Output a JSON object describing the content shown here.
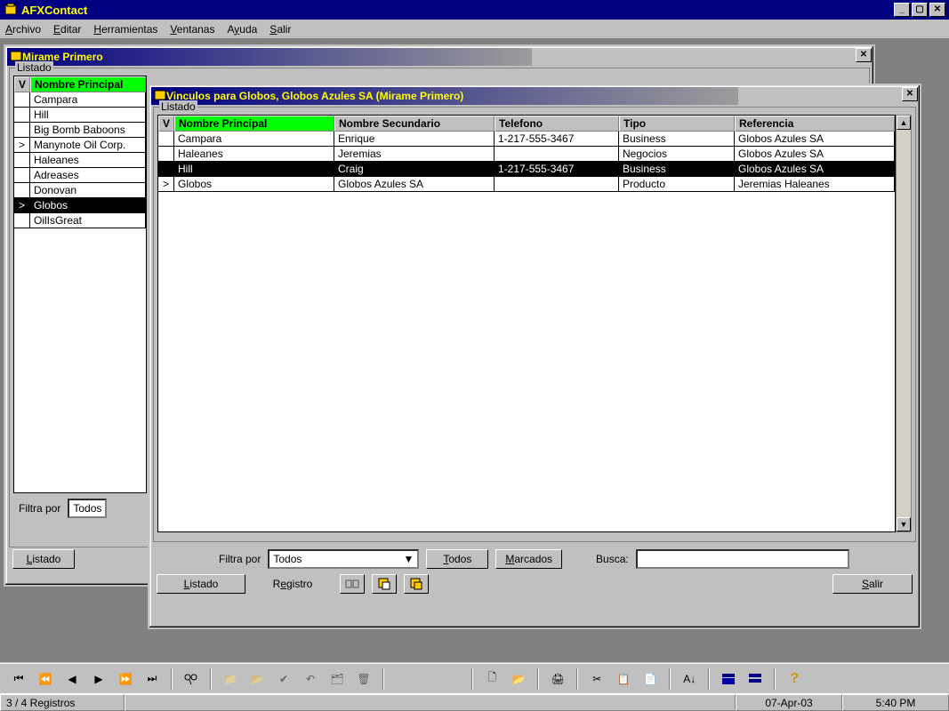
{
  "app": {
    "title": "AFXContact"
  },
  "menu": {
    "archivo": "Archivo",
    "editar": "Editar",
    "herramientas": "Herramientas",
    "ventanas": "Ventanas",
    "ayuda": "Ayuda",
    "salir": "Salir"
  },
  "win1": {
    "title": "Mirame Primero",
    "listado": "Listado",
    "headers": {
      "v": "V",
      "nombre": "Nombre Principal"
    },
    "rows": [
      {
        "m": "",
        "name": "Campara",
        "sel": false
      },
      {
        "m": "",
        "name": "Hill",
        "sel": false
      },
      {
        "m": "",
        "name": "Big Bomb Baboons",
        "sel": false
      },
      {
        "m": ">",
        "name": "Manynote Oil Corp.",
        "sel": false
      },
      {
        "m": "",
        "name": "Haleanes",
        "sel": false
      },
      {
        "m": "",
        "name": "Adreases",
        "sel": false
      },
      {
        "m": "",
        "name": "Donovan",
        "sel": false
      },
      {
        "m": ">",
        "name": "Globos",
        "sel": true
      },
      {
        "m": "",
        "name": "OilIsGreat",
        "sel": false
      }
    ],
    "filtra": "Filtra por",
    "filtra_val": "Todos",
    "btn_listado": "Listado"
  },
  "win2": {
    "title": "Vinculos para Globos, Globos Azules SA (Mirame Primero)",
    "listado": "Listado",
    "headers": {
      "v": "V",
      "nombre": "Nombre Principal",
      "sec": "Nombre Secundario",
      "tel": "Telefono",
      "tipo": "Tipo",
      "ref": "Referencia"
    },
    "rows": [
      {
        "m": "",
        "p": "Campara",
        "s": "Enrique",
        "t": "1-217-555-3467",
        "ti": "Business",
        "r": "Globos Azules SA",
        "sel": false
      },
      {
        "m": "",
        "p": "Haleanes",
        "s": "Jeremias",
        "t": "",
        "ti": "Negocios",
        "r": "Globos Azules SA",
        "sel": false
      },
      {
        "m": "",
        "p": "Hill",
        "s": "Craig",
        "t": "1-217-555-3467",
        "ti": "Business",
        "r": "Globos Azules SA",
        "sel": true
      },
      {
        "m": ">",
        "p": "Globos",
        "s": "Globos Azules SA",
        "t": "",
        "ti": "Producto",
        "r": "Jeremias Haleanes",
        "sel": false
      }
    ],
    "filtra": "Filtra por",
    "filtra_val": "Todos",
    "todos": "Todos",
    "marcados": "Marcados",
    "busca": "Busca:",
    "btn_listado": "Listado",
    "btn_registro": "Registro",
    "btn_salir": "Salir"
  },
  "status": {
    "records": "3 / 4 Registros",
    "date": "07-Apr-03",
    "time": "5:40 PM"
  }
}
